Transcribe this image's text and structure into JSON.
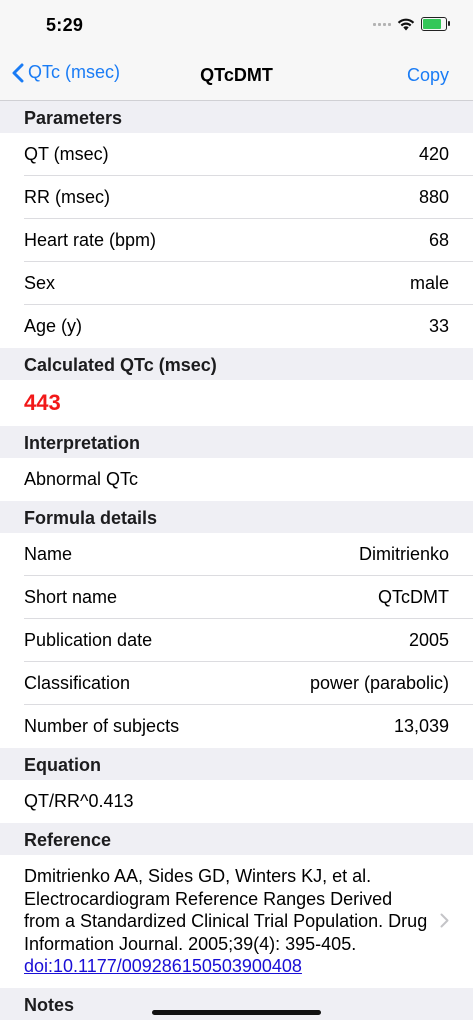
{
  "status": {
    "time": "5:29"
  },
  "nav": {
    "back_label": "QTc (msec)",
    "title": "QTcDMT",
    "copy_label": "Copy"
  },
  "sections": {
    "parameters": "Parameters",
    "calculated": "Calculated QTc (msec)",
    "interpretation": "Interpretation",
    "formula": "Formula details",
    "equation": "Equation",
    "reference": "Reference",
    "notes": "Notes"
  },
  "parameters": [
    {
      "label": "QT (msec)",
      "value": "420"
    },
    {
      "label": "RR (msec)",
      "value": "880"
    },
    {
      "label": "Heart rate (bpm)",
      "value": "68"
    },
    {
      "label": "Sex",
      "value": "male"
    },
    {
      "label": "Age (y)",
      "value": "33"
    }
  ],
  "calculated_value": "443",
  "interpretation_text": "Abnormal QTc",
  "formula": [
    {
      "label": "Name",
      "value": "Dimitrienko"
    },
    {
      "label": "Short name",
      "value": "QTcDMT"
    },
    {
      "label": "Publication date",
      "value": "2005"
    },
    {
      "label": "Classification",
      "value": "power (parabolic)"
    },
    {
      "label": "Number of subjects",
      "value": "13,039"
    }
  ],
  "equation_text": "QT/RR^0.413",
  "reference": {
    "text": "Dmitrienko AA, Sides GD, Winters KJ, et al. Electrocardiogram Reference Ranges Derived from a Standardized Clinical Trial Population. Drug Information Journal. 2005;39(4): 395-405.",
    "link": "doi:10.1177/009286150503900408"
  },
  "colors": {
    "accent": "#1a7cf5",
    "result": "#f21818",
    "header_bg": "#efeff4"
  }
}
